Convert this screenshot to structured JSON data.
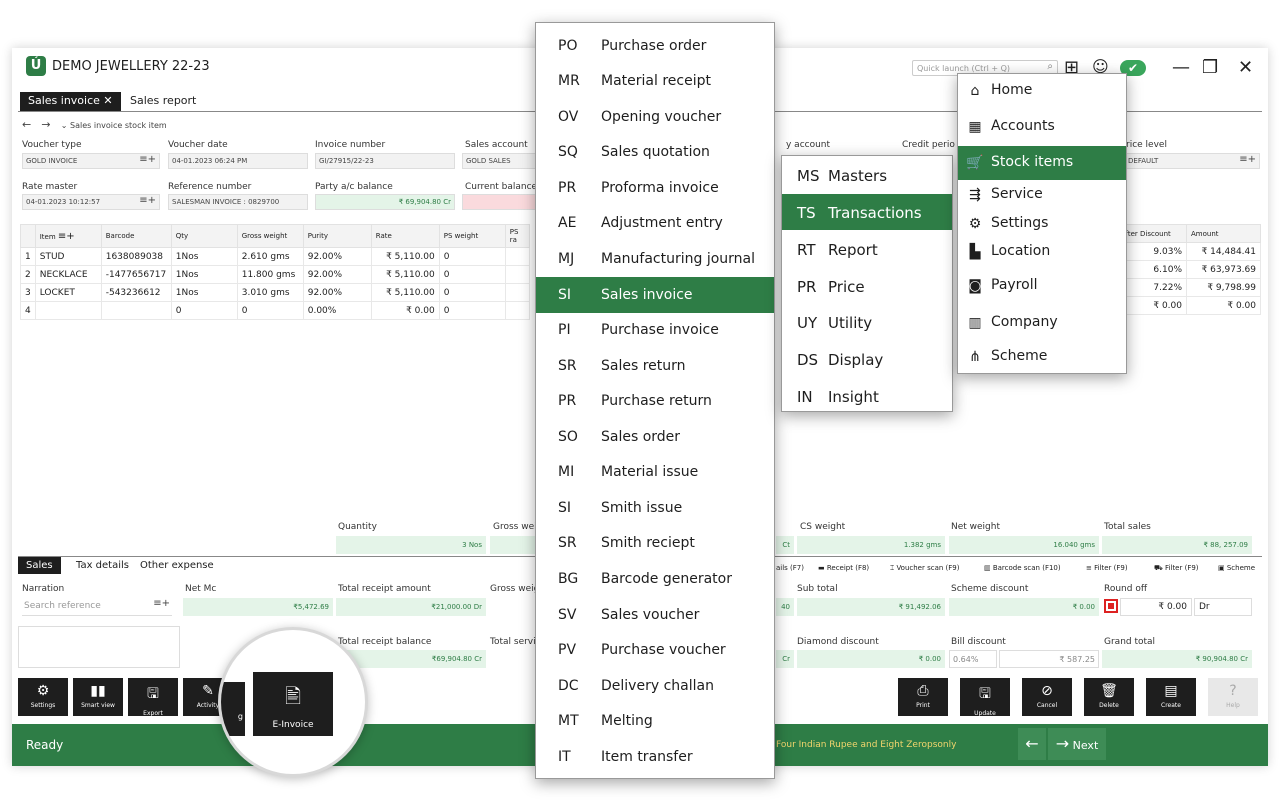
{
  "app": {
    "logo": "Ú",
    "title": "DEMO JEWELLERY 22-23",
    "quick_launch_placeholder": "Quick launch (Ctrl + Q)",
    "tabs": [
      "Sales invoice",
      "Sales report"
    ],
    "breadcrumb": "Sales invoice stock item"
  },
  "form": {
    "voucher_type_label": "Voucher type",
    "voucher_type_value": "GOLD INVOICE",
    "voucher_date_label": "Voucher date",
    "voucher_date_value": "04-01.2023 06:24 PM",
    "invoice_number_label": "Invoice number",
    "invoice_number_value": "GI/27915/22-23",
    "sales_account_label": "Sales account",
    "sales_account_value": "GOLD SALES",
    "party_account_label": "y account",
    "credit_period_label": "Credit perio",
    "price_level_label": "rice level",
    "price_level_value": "DEFAULT",
    "rate_master_label": "Rate master",
    "rate_master_value": "04-01.2023 10:12:57",
    "reference_number_label": "Reference number",
    "reference_number_value": "SALESMAN INVOICE : 0829700",
    "party_balance_label": "Party a/c balance",
    "party_balance_value": "₹ 69,904.80  Cr",
    "current_balance_label": "Current balance"
  },
  "items_table": {
    "headers": [
      "Item",
      "Barcode",
      "Qty",
      "Gross weight",
      "Purity",
      "Rate",
      "PS weight",
      "PS ra"
    ],
    "rows": [
      [
        "1",
        "STUD",
        "1638089038",
        "1Nos",
        "2.610 gms",
        "92.00%",
        "₹ 5,110.00",
        "0"
      ],
      [
        "2",
        "NECKLACE",
        "-1477656717",
        "1Nos",
        "11.800 gms",
        "92.00%",
        "₹ 5,110.00",
        "0"
      ],
      [
        "3",
        "LOCKET",
        "-543236612",
        "1Nos",
        "3.010 gms",
        "92.00%",
        "₹ 5,110.00",
        "0"
      ],
      [
        "4",
        "",
        "",
        "0",
        "0",
        "0.00%",
        "₹ 0.00",
        "0"
      ]
    ],
    "right_headers": [
      "After Discount",
      "Amount"
    ],
    "right_rows": [
      [
        "9.03%",
        "₹ 14,484.41"
      ],
      [
        "6.10%",
        "₹ 63,973.69"
      ],
      [
        "7.22%",
        "₹ 9,798.99"
      ],
      [
        "₹ 0.00",
        "₹ 0.00"
      ]
    ]
  },
  "summary": {
    "quantity_label": "Quantity",
    "quantity_value": "3 Nos",
    "gross_weight_label": "Gross weig",
    "cs_weight_label": "CS weight",
    "cs_weight_value": "1.382 gms",
    "cs_prefix": "Ct",
    "net_weight_label": "Net weight",
    "net_weight_value": "16.040 gms",
    "total_sales_label": "Total sales",
    "total_sales_value": "₹ 88, 257.09"
  },
  "subtabs": [
    "Sales",
    "Tax details",
    "Other expense"
  ],
  "shortcuts": [
    "ails (F7)",
    "Receipt (F8)",
    "Voucher scan (F9)",
    "Barcode scan (F10)",
    "Filter (F9)",
    "Filter (F9)",
    "Scheme"
  ],
  "bottom": {
    "narration_label": "Narration",
    "narration_placeholder": "Search reference",
    "net_mc_label": "Net Mc",
    "net_mc_value": "₹5,472.69",
    "total_receipt_amount_label": "Total receipt amount",
    "total_receipt_amount_value": "₹21,000.00  Dr",
    "gross_weight_label": "Gross weig",
    "sub_total_label": "Sub total",
    "sub_total_value": "₹ 91,492.06",
    "sub_total_left": "40",
    "scheme_discount_label": "Scheme discount",
    "scheme_discount_value": "₹ 0.00",
    "round_off_label": "Round off",
    "round_off_value": "₹ 0.00",
    "round_off_dr": "Dr",
    "total_receipt_balance_label": "Total receipt balance",
    "total_receipt_balance_value": "₹69,904.80  Cr",
    "total_service_label": "Total servic",
    "diamond_discount_label": "Diamond discount",
    "diamond_discount_value": "₹ 0.00",
    "diamond_left": "Cr",
    "bill_discount_label": "Bill discount",
    "bill_discount_pct": "0.64%",
    "bill_discount_value": "₹ 587.25",
    "grand_total_label": "Grand total",
    "grand_total_value": "₹ 90,904.80  Cr"
  },
  "left_buttons": [
    {
      "label": "Settings",
      "icon": "⚙"
    },
    {
      "label": "Smart view",
      "icon": "▮▮"
    },
    {
      "label": "Export",
      "icon": "🖫"
    },
    {
      "label": "Activity",
      "icon": "✎"
    }
  ],
  "right_buttons": [
    {
      "label": "Print",
      "icon": "⎙"
    },
    {
      "label": "Update",
      "icon": "🖫"
    },
    {
      "label": "Cancel",
      "icon": "⊘"
    },
    {
      "label": "Delete",
      "icon": "🗑"
    },
    {
      "label": "Create",
      "icon": "▤"
    },
    {
      "label": "Help",
      "icon": "?"
    }
  ],
  "magnifier": {
    "button_label": "E-Invoice",
    "icon": "🖹",
    "left_partial": "g"
  },
  "status": {
    "text": "Ready",
    "amount_words": "Four Indian Rupee and Eight Zeropsonly",
    "back_icon": "←",
    "next_icon": "→",
    "next_label": "Next"
  },
  "transactions_menu": [
    {
      "code": "PO",
      "name": "Purchase order"
    },
    {
      "code": "MR",
      "name": "Material receipt"
    },
    {
      "code": "OV",
      "name": "Opening voucher"
    },
    {
      "code": "SQ",
      "name": "Sales quotation"
    },
    {
      "code": "PR",
      "name": "Proforma invoice"
    },
    {
      "code": "AE",
      "name": "Adjustment entry"
    },
    {
      "code": "MJ",
      "name": "Manufacturing journal"
    },
    {
      "code": "SI",
      "name": "Sales invoice"
    },
    {
      "code": "PI",
      "name": "Purchase invoice"
    },
    {
      "code": "SR",
      "name": "Sales return"
    },
    {
      "code": "PR",
      "name": "Purchase return"
    },
    {
      "code": "SO",
      "name": "Sales order"
    },
    {
      "code": "MI",
      "name": "Material issue"
    },
    {
      "code": "SI",
      "name": "Smith issue"
    },
    {
      "code": "SR",
      "name": "Smith reciept"
    },
    {
      "code": "BG",
      "name": "Barcode generator"
    },
    {
      "code": "SV",
      "name": "Sales voucher"
    },
    {
      "code": "PV",
      "name": "Purchase voucher"
    },
    {
      "code": "DC",
      "name": "Delivery challan"
    },
    {
      "code": "MT",
      "name": "Melting"
    },
    {
      "code": "IT",
      "name": "Item transfer"
    }
  ],
  "category_menu": [
    {
      "code": "MS",
      "name": "Masters"
    },
    {
      "code": "TS",
      "name": "Transactions"
    },
    {
      "code": "RT",
      "name": "Report"
    },
    {
      "code": "PR",
      "name": "Price"
    },
    {
      "code": "UY",
      "name": "Utility"
    },
    {
      "code": "DS",
      "name": "Display"
    },
    {
      "code": "IN",
      "name": "Insight"
    }
  ],
  "main_menu": [
    {
      "icon": "⌂",
      "name": "Home"
    },
    {
      "icon": "▦",
      "name": "Accounts"
    },
    {
      "icon": "🛒",
      "name": "Stock items"
    },
    {
      "icon": "⇶",
      "name": "Service"
    },
    {
      "icon": "⚙",
      "name": "Settings"
    },
    {
      "icon": "▙",
      "name": "Location"
    },
    {
      "icon": "◙",
      "name": "Payroll"
    },
    {
      "icon": "▥",
      "name": "Company"
    },
    {
      "icon": "⋔",
      "name": "Scheme"
    }
  ],
  "colors": {
    "accent": "#2e7d46",
    "dark": "#1e1e1e",
    "warn_text": "#f1d56d"
  }
}
